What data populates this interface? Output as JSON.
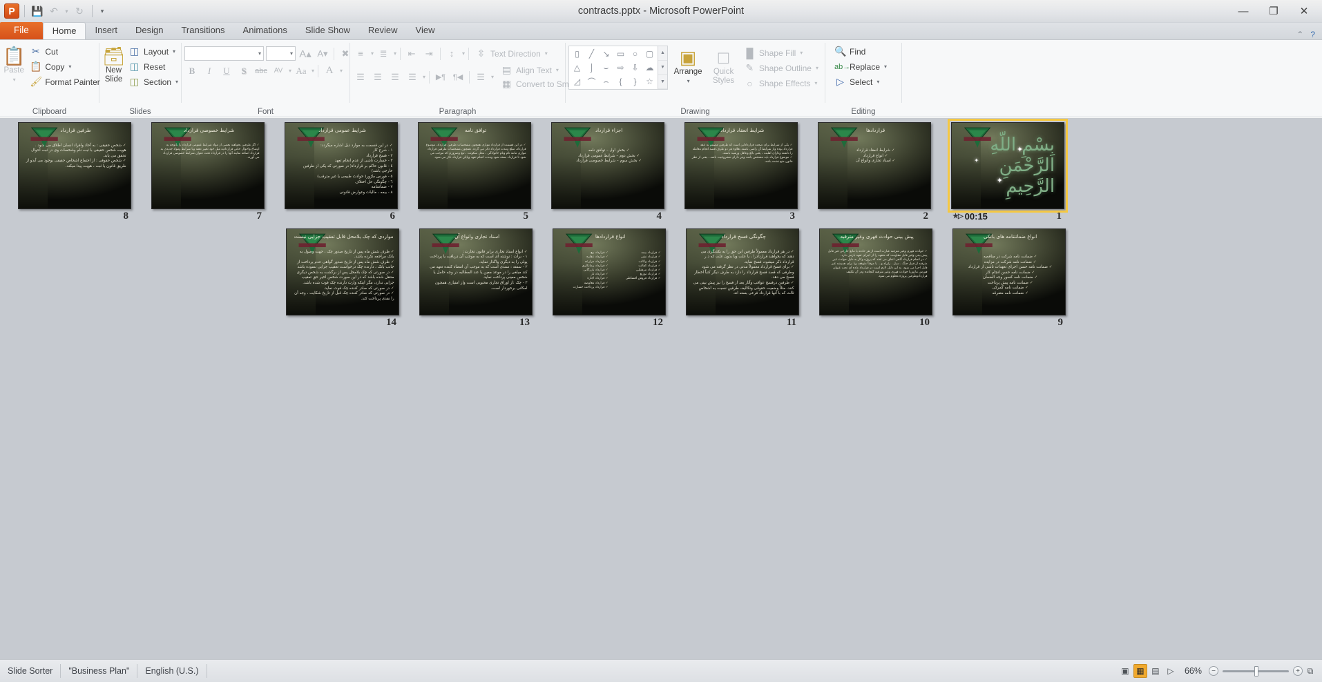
{
  "window": {
    "title": "contracts.pptx - Microsoft PowerPoint",
    "app_logo": "P",
    "minimize": "—",
    "restore": "❐",
    "close": "✕"
  },
  "quick_access": [
    {
      "name": "save-icon",
      "glyph": "💾"
    },
    {
      "name": "undo-icon",
      "glyph": "↶"
    },
    {
      "name": "undo-dropdown-icon",
      "glyph": "▾"
    },
    {
      "name": "redo-icon",
      "glyph": "↻"
    },
    {
      "name": "customize-qat-icon",
      "glyph": "▾"
    }
  ],
  "tabs": [
    {
      "label": "File",
      "active": false,
      "file": true
    },
    {
      "label": "Home",
      "active": true
    },
    {
      "label": "Insert",
      "active": false
    },
    {
      "label": "Design",
      "active": false
    },
    {
      "label": "Transitions",
      "active": false
    },
    {
      "label": "Animations",
      "active": false
    },
    {
      "label": "Slide Show",
      "active": false
    },
    {
      "label": "Review",
      "active": false
    },
    {
      "label": "View",
      "active": false
    }
  ],
  "tab_right": [
    {
      "name": "minimize-ribbon-icon",
      "glyph": "⌃"
    },
    {
      "name": "help-icon",
      "glyph": "?"
    }
  ],
  "ribbon": {
    "clipboard": {
      "label": "Clipboard",
      "paste": "Paste",
      "cut": "Cut",
      "copy": "Copy",
      "format_painter": "Format Painter"
    },
    "slides": {
      "label": "Slides",
      "new_slide": "New\nSlide",
      "new_slide_line1": "New",
      "new_slide_line2": "Slide",
      "layout": "Layout",
      "reset": "Reset",
      "section": "Section"
    },
    "font": {
      "label": "Font",
      "font_name": "",
      "font_size": "",
      "grow": "A",
      "shrink": "A",
      "clear_formatting": "Aa",
      "bold": "B",
      "italic": "I",
      "underline": "U",
      "shadow": "S",
      "strikethrough": "abc",
      "character_spacing": "AV",
      "change_case": "Aa",
      "font_color": "A"
    },
    "paragraph": {
      "label": "Paragraph",
      "text_direction": "Text Direction",
      "align_text": "Align Text",
      "convert_to_smartart": "Convert to SmartArt"
    },
    "drawing": {
      "label": "Drawing",
      "arrange": "Arrange",
      "quick_styles_line1": "Quick",
      "quick_styles_line2": "Styles",
      "shape_fill": "Shape Fill",
      "shape_outline": "Shape Outline",
      "shape_effects": "Shape Effects"
    },
    "editing": {
      "label": "Editing",
      "find": "Find",
      "replace": "Replace",
      "select": "Select"
    }
  },
  "slides": [
    {
      "number": "8",
      "title": "طرفین قرارداد",
      "body": [
        "شخص حقیقی : به آحاد وافراد انسان اطلاق می شود . هویت شخص حقیقی با ثبت نام وشخصات وی در ثبت احوال تحقق می یابد.",
        "شخص حقوقی : از اجتماع اشخاص حقیقی بوجود می آیدو از طریق قانون یا ثبت ، هویت پیدا میکند."
      ],
      "body_style": "bullets"
    },
    {
      "number": "7",
      "title": "شرایط خصوصی قرارداد",
      "body": [
        "اگر طرفین بخواهند بعضی از مواد شرایط عمومی قرارداد را باتوجه به اوضاع واحوال خاص قراردادیه میل خود تغییر دهند ویا شرایط ومواد جدیدی به قرارداد اضافه نمایند آنها را در قرارداد تحت عنوان شرایط خصوصی قرارداد می آورند."
      ],
      "body_style": "bullets"
    },
    {
      "number": "6",
      "title": "شرایط عمومی قرارداد",
      "body": [
        "در این قسمت به موارد ذیل اشاره میگردد:",
        "١ - شرح کار",
        "٢ - فسخ قرارداد",
        "٣ - خسارت ناشی از عدم انجام تعهد",
        "٤ - قانون حاکم بر قرارداد( در صورتی که یکی از طرفین خارجی باشد)",
        "٥ - فورس ماژور( حوادث طبیعی یا غیر مترقب)",
        "٦ - چگونگی حل اختلاف",
        "٧ - ضمانتنامه",
        "٨ - بیمه ، مالیات وعوارض قانونی"
      ],
      "body_style": "numbered"
    },
    {
      "number": "5",
      "title": "توافق نامه",
      "body": [
        "در این قسمت از قرارداد مواری همچون مشخصات طرفین قرارداد، موضوع قرارداد، مبلغ ومدت قرارداد ذکر می گردد. همچون مشخصات طرفین قرارداد مواری مانند نام ونام خانوادگی ، محل سکونت ، تبع وضروری که موجب می شود تا قرارداد بسته شود ومدت انجام تعهد وپایان قرارداد ذکر می شود."
      ],
      "body_style": "bullets"
    },
    {
      "number": "4",
      "title": "اجزاء قرارداد",
      "body": [
        "بخش اول – توافق نامه",
        "بخش دوم – شرایط عمومی قرارداد",
        "بخش سوم – شرایط خصوصی قرارداد"
      ],
      "body_style": "center-bullets"
    },
    {
      "number": "3",
      "title": "شرایط انعقاد قرارداد",
      "body": [
        "یکی از شرایط برای صحت قرارداداین است که طرفین مصمم به عقد قرارداد بوده واز شرایط آن راضی باشند بعلاوه هر دو طرف قصد انجام معامله را داشته ودارای اهلیت ، یعنی بالغ وعاقل ورشید باشند.",
        "موضوع قرارداد باید مشخص باشد ونیز دارای مشروعیت باشد ، یعنی از نظر قانون منع نشده باشد."
      ],
      "body_style": "bullets"
    },
    {
      "number": "2",
      "title": "قراردادها",
      "body": [
        "شرایط انعقاد قرارداد",
        "انواع قرارداد",
        "اسناد تجاری وانواع آن"
      ],
      "body_style": "center-bullets"
    },
    {
      "number": "1",
      "title": "",
      "body": [],
      "body_style": "calligraphy",
      "calligraphy": "بِسْمِ اللّهِ الرَّحْمَنِ الرَّحِيمِ",
      "selected": true,
      "timing": "00:15"
    },
    {
      "number": "14",
      "title": "مواردی که چک بلامحل قابل تعقیب جزایی نیست",
      "title_wrap": true,
      "body": [
        "ظرف شش ماه پس از تاریخ صدور چک ، جهت وصول به بانک مراجعه نکرده باشد.",
        "ظرف شش ماه پس از تاریخ صدور گواهی عدم پرداخت از جانب بانک ، دارنده چک درخواست تعقیب جزایی ننموده باشد",
        "در صورتی که چک بلامحل پس از برگشت به شخص دیگری منتقل شده باشد که در این صورت شخص اخیر حق تعقیب جزایی ندارد، مگر اینکه وارث دارنده چک فوت شده باشد.",
        "در صورتی که صادر کننده چک فوت نماید.",
        "در صورتی که صادر کننده چک قبل از تاریخ شکایت ، وجه آن را نقدی پرداخت کند."
      ],
      "body_style": "bullets"
    },
    {
      "number": "13",
      "title": "اسناد تجاری وانواع آن",
      "body": [
        "انواع اسناد تجاری برابر قانون تجارت:",
        "١ - برات : نوشته ای است که به موجب آن دریافت یا پرداخت پولی را به دیگری واگذار نماید.",
        "٢ - سفته : سندی است که به موجب آن امضاء کننده تعهد می کند مبلغی را در موعد معین یا عند المطالبه در وجه حامل یا شخص معینی پرداخت نماید.",
        "٣ - چک :از اوراق تجاری محبوبی است واز امتیازی همچون امکانی برخوردار است."
      ],
      "body_style": "numbered"
    },
    {
      "number": "12",
      "title": "انواع قراردادها",
      "body_col_right": [
        "قرارداد بیع",
        "قرارداد عقاره",
        "قرارداد مزارعه",
        "قرارداد پیمانکاری",
        "قرارداد بازرگانی",
        "قرارداد ثار",
        "قرارداد اجاره",
        "قرارداد معاوضه",
        "قرارداد پرداخت خسارت"
      ],
      "body_col_left": [
        "قرارداد بیمه",
        "قرارداد نشر",
        "قرارداد وکالت",
        "قرارداد کفالت",
        "قرارداد مرهنتلی",
        "قرارداد توزیع",
        "قرارداد فروش اقساطی"
      ],
      "body": [],
      "body_style": "two-column"
    },
    {
      "number": "11",
      "title": "چگونگی فسخ قرارداد",
      "body": [
        "در هر قرارداد معمولاً طرفین این حق را به یکدیگری می دهند که بخواهند قراردادرا ، یا علت ویا بدون علت که د ر قرارداد ذکر میشود، فسخ نماید.",
        "برای فسخ قرارداد معمولاً مدتی در نظر گرفته می شود وطرفی که قصد فسخ قرارداد را دارد به طرف دیگر کتباً اخطار فسخ می دهد.",
        "طرفین درفسخ عواقب وآثار بعد از فسخ را نیز پیش بینی می کنند، مثلاً وضعیت حقوقی وتکالیف طرفین نسبت به اشخاص ثالث که با آنها قرارداد فرعی بسته اند."
      ],
      "body_style": "bullets"
    },
    {
      "number": "10",
      "title": "پیش بینی حوادث قهری وغیر مترقبه",
      "body": [
        "حوادث قهری وغیر مترقبه عبارت است از هر حادثه یا مانع خارجی غیر قابل پیش بینی وغیر قابل مقاومت که متعهد را از اجرای تعهد بازمی دارد.",
        "در انجام قرارداد گاهی اتفاق می افتد که پروژه وکار به دلیل حوادث غیر مترقبه از قبیل جنگ ، سیل ، زلزله و... یا موقتاً متوقف ویا برای همیشه غیر قابل اجرا می شود. به این دلیل لازم است در قرارداد ماده ای تحت عنوان فورس ماژوریا حوادث قهری وغیر مترقبه گنجانده ودر آن تکلیف قراردادوطرفین پروژه معلوم می شود."
      ],
      "body_style": "bullets"
    },
    {
      "number": "9",
      "title": "انواع ضمانتنامه های بانکی",
      "body": [
        "ضمانت نامه شرکت در مناقصه",
        "ضمانت نامه شرکت در مزایده",
        "ضمانت نامه حسن اجرای تعهدات ناشی از قرارداد",
        "ضمانت نامه حسن انجام کار",
        "ضمانت نامه کسور وجه الضمان",
        "ضمانت نامه پیش پرداخت",
        "ضمانت نامه گمرکی",
        "ضمانت نامه متفرقه"
      ],
      "body_style": "center-bullets"
    }
  ],
  "statusbar": {
    "view_name": "Slide Sorter",
    "theme": "\"Business Plan\"",
    "language": "English (U.S.)",
    "zoom_level": "66%",
    "views": [
      {
        "name": "normal-view-button",
        "glyph": "▣",
        "active": false
      },
      {
        "name": "slide-sorter-view-button",
        "glyph": "▦",
        "active": true
      },
      {
        "name": "reading-view-button",
        "glyph": "▤",
        "active": false
      },
      {
        "name": "slide-show-button",
        "glyph": "▷",
        "active": false
      }
    ],
    "zoom_out": "−",
    "zoom_in": "+",
    "fit_to_window": "⧉"
  }
}
